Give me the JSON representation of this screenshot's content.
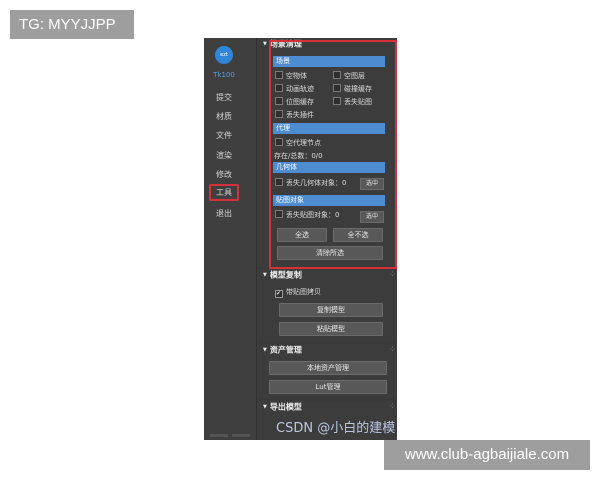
{
  "watermarks": {
    "top_left": "TG: MYYJJPP",
    "bottom_right": "www.club-agbaijiale.com"
  },
  "sidebar": {
    "logo_text": "ezt",
    "version": "Tk100",
    "items": [
      {
        "label": "提交"
      },
      {
        "label": "材质"
      },
      {
        "label": "文件"
      },
      {
        "label": "渲染"
      },
      {
        "label": "修改"
      },
      {
        "label": "工具",
        "active": true
      },
      {
        "label": "退出"
      }
    ]
  },
  "scene_clean": {
    "title": "场景清理",
    "scene_bar": "场景",
    "checks": [
      "空物体",
      "空图层",
      "动画轨迹",
      "碰撞缓存",
      "位图缓存",
      "丢失贴图",
      "丢失插件"
    ],
    "proxy_bar": "代理",
    "empty_proxy": "空代理节点",
    "stats": "存在/总数：0/0",
    "geometry_bar": "几何体",
    "lost_geometry": "丢失几何体对象：0",
    "select_label": "选中",
    "texture_bar": "贴图对象",
    "lost_texture": "丢失贴图对象：0",
    "select_all": "全选",
    "select_none": "全不选",
    "clear_selected": "清除所选"
  },
  "model_copy": {
    "title": "模型复制",
    "with_texture": "带贴图拷贝",
    "with_texture_checked": true,
    "copy_model": "复制模型",
    "paste_model": "粘贴模型"
  },
  "asset": {
    "title": "资产管理",
    "local_asset": "本地资产管理",
    "lut": "Lut管理"
  },
  "export": {
    "title": "导出模型",
    "overlay_text": "CSDN @小白的建模"
  }
}
